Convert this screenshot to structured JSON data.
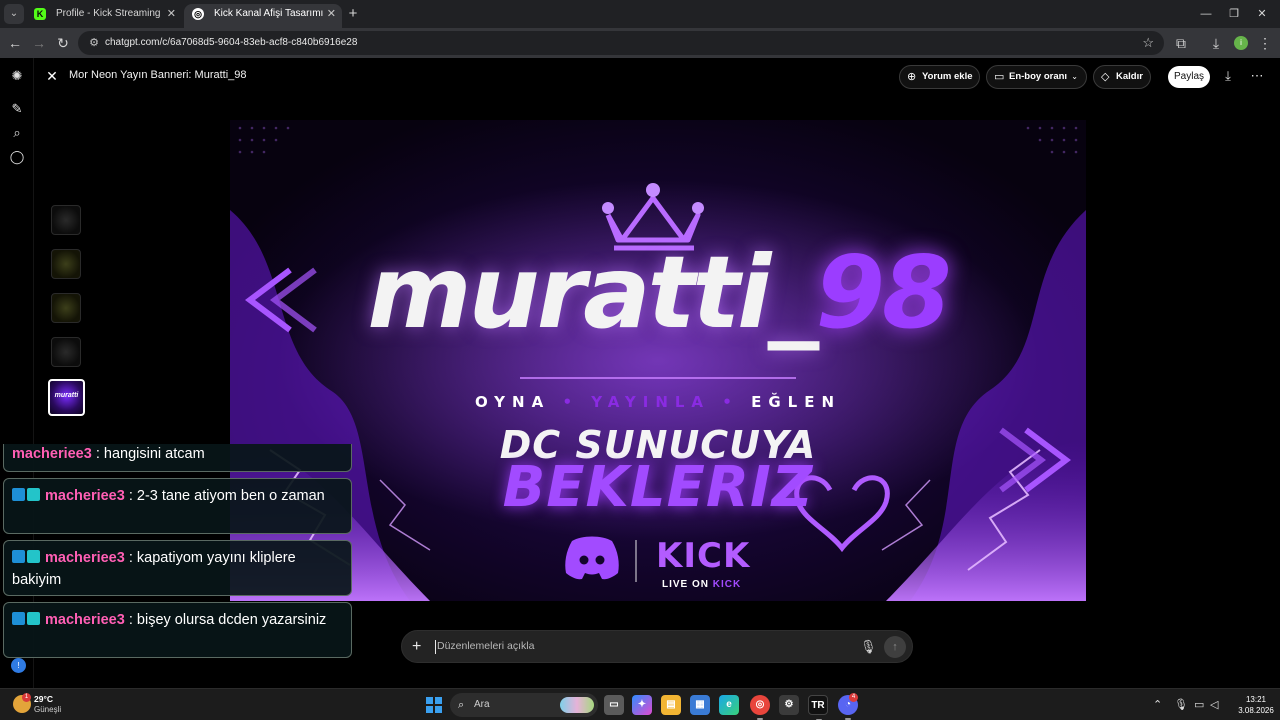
{
  "browser": {
    "tabs": [
      {
        "title": "Profile - Kick Streaming",
        "favicon": "K"
      },
      {
        "title": "Kick Kanal Afişi Tasarımı",
        "favicon": "◎"
      }
    ],
    "url": "chatgpt.com/c/6a7068d5-9604-83eb-acf8-c840b6916e28",
    "profile_initial": "i"
  },
  "header": {
    "title": "Mor Neon Yayın Banneri: Muratti_98",
    "add_comment": "Yorum ekle",
    "aspect_ratio": "En-boy oranı",
    "remove": "Kaldır",
    "share": "Paylaş"
  },
  "thumbnails": [
    {
      "label": ""
    },
    {
      "label": ""
    },
    {
      "label": ""
    },
    {
      "label": ""
    },
    {
      "label": "muratti"
    }
  ],
  "banner": {
    "name_main": "muratti_",
    "name_accent": "98",
    "tag_left": "OYNA",
    "tag_mid": "YAYINLA",
    "tag_right": "EĞLEN",
    "tag_sep": "•",
    "line1": "DC SUNUCUYA",
    "line2": "BEKLERIZ",
    "kick_word": "KICK",
    "kick_sub_main": "LIVE ON",
    "kick_sub_accent": "KICK",
    "colors": {
      "purple": "#9b3dff",
      "deep": "#14052e",
      "white": "#f3f3f3"
    }
  },
  "prompt": {
    "placeholder": "Düzenlemeleri açıkla"
  },
  "chat": {
    "top_partial": {
      "user": "macheriee3",
      "text": "hangisini atcam"
    },
    "messages": [
      {
        "user": "macheriee3",
        "text": "2-3 tane atiyom ben o zaman"
      },
      {
        "user": "macheriee3",
        "text": "kapatiyom yayını kliplere bakiyim"
      },
      {
        "user": "macheriee3",
        "text": "bişey olursa dcden yazarsiniz"
      }
    ]
  },
  "taskbar": {
    "temp": "29°C",
    "condition": "Güneşli",
    "search": "Ara",
    "tr_label": "TR",
    "discord_badge": "4",
    "time": "13:21",
    "date": "3.08.2026"
  }
}
